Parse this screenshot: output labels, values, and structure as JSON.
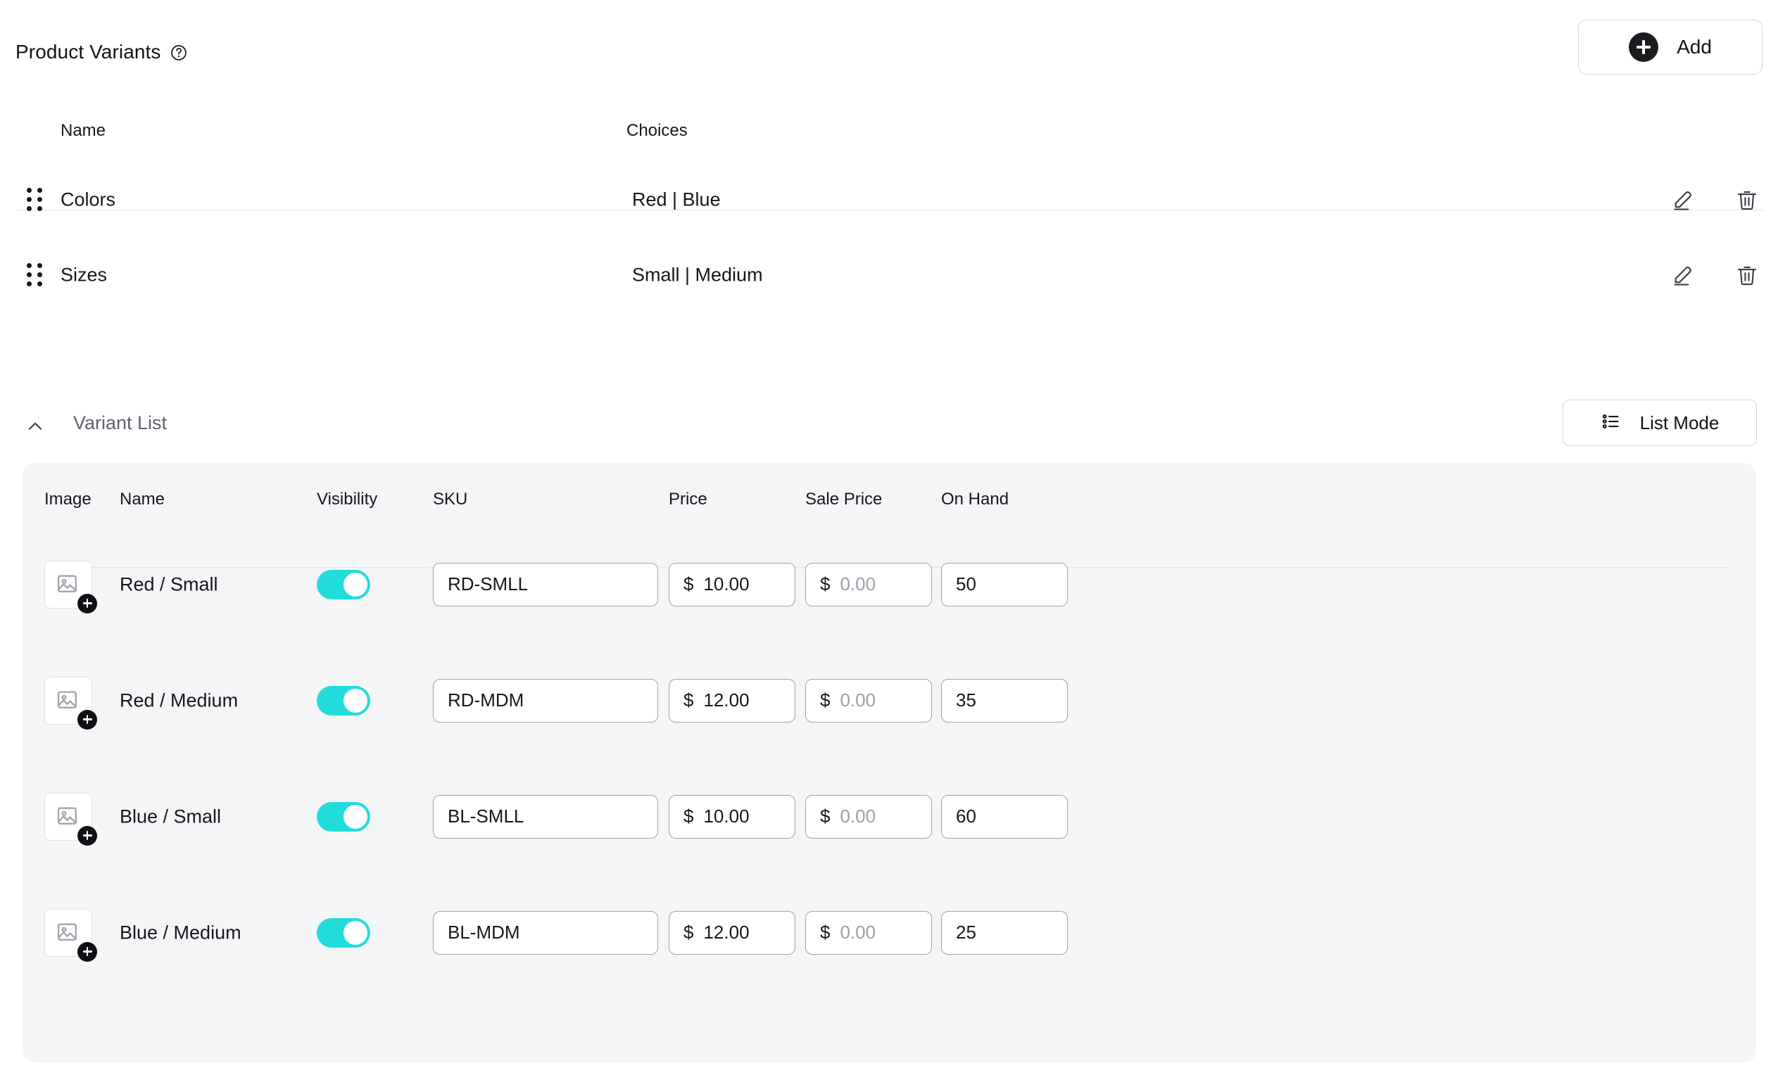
{
  "header": {
    "title": "Product Variants",
    "help_icon": "question-circle-icon",
    "add_label": "Add",
    "add_icon": "plus-circle-icon"
  },
  "options_table": {
    "columns": [
      "Name",
      "Choices"
    ],
    "rows": [
      {
        "name": "Colors",
        "choices": "Red | Blue",
        "edit_icon": "pencil-icon",
        "delete_icon": "trash-icon"
      },
      {
        "name": "Sizes",
        "choices": "Small | Medium",
        "edit_icon": "pencil-icon",
        "delete_icon": "trash-icon"
      }
    ]
  },
  "variant_list": {
    "collapse_icon": "chevron-up-icon",
    "label": "Variant List",
    "list_mode_label": "List Mode",
    "list_mode_icon": "list-bullet-icon",
    "columns": [
      "Image",
      "Name",
      "Visibility",
      "SKU",
      "Price",
      "Sale Price",
      "On Hand"
    ],
    "currency_symbol": "$",
    "sale_price_placeholder": "0.00",
    "rows": [
      {
        "name": "Red / Small",
        "visible": true,
        "sku": "RD-SMLL",
        "price": "10.00",
        "sale_price": "0.00",
        "on_hand": "50"
      },
      {
        "name": "Red / Medium",
        "visible": true,
        "sku": "RD-MDM",
        "price": "12.00",
        "sale_price": "0.00",
        "on_hand": "35"
      },
      {
        "name": "Blue / Small",
        "visible": true,
        "sku": "BL-SMLL",
        "price": "10.00",
        "sale_price": "0.00",
        "on_hand": "60"
      },
      {
        "name": "Blue / Medium",
        "visible": true,
        "sku": "BL-MDM",
        "price": "12.00",
        "sale_price": "0.00",
        "on_hand": "25"
      }
    ]
  },
  "colors": {
    "toggle_on": "#22dcdc",
    "panel_background": "#f4f5f7",
    "text": "#16171d",
    "muted_text": "#5d636e",
    "border": "#d4d7dd"
  }
}
